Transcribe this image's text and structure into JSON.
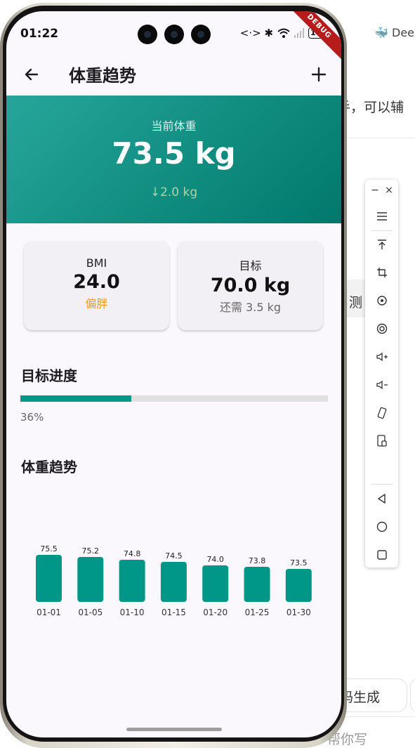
{
  "background": {
    "deep_label": "Deep",
    "line1": "手，可以辅",
    "detect": "测",
    "code_gen": "码生成",
    "write": "帮你写"
  },
  "status_bar": {
    "time": "01:22",
    "icons": "<·> ✱",
    "battery": "100",
    "debug_banner": "DEBUG"
  },
  "app_bar": {
    "title": "体重趋势",
    "back_icon": "arrow-left-icon",
    "add_icon": "plus-icon"
  },
  "hero": {
    "label": "当前体重",
    "value": "73.5 kg",
    "change": "↓2.0 kg"
  },
  "cards": [
    {
      "label": "BMI",
      "value": "24.0",
      "sub": "偏胖",
      "sub_color": "#ff9800"
    },
    {
      "label": "目标",
      "value": "70.0 kg",
      "sub": "还需 3.5 kg",
      "sub_color": "#666666"
    }
  ],
  "progress": {
    "title": "目标进度",
    "fraction": 0.36,
    "label": "36%"
  },
  "trend_title": "体重趋势",
  "chart_data": {
    "type": "bar",
    "categories": [
      "01-01",
      "01-05",
      "01-10",
      "01-15",
      "01-20",
      "01-25",
      "01-30"
    ],
    "values": [
      75.5,
      75.2,
      74.8,
      74.5,
      74.0,
      73.8,
      73.5
    ],
    "data_labels": [
      "75.5",
      "75.2",
      "74.8",
      "74.5",
      "74.0",
      "73.8",
      "73.5"
    ],
    "color": "#009688"
  },
  "toolbar": {
    "minimize": "−",
    "close": "×",
    "buttons": [
      "menu-icon",
      "pin-top-icon",
      "crop-icon",
      "rotate-icon",
      "record-icon",
      "volume-up-icon",
      "volume-down-icon",
      "rotate-device-icon",
      "screenshot-icon",
      "back-icon",
      "home-icon",
      "recents-icon"
    ]
  }
}
